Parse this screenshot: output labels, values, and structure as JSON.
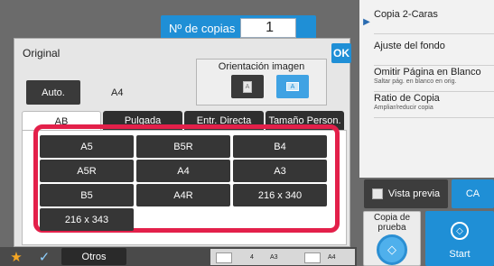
{
  "copies": {
    "label": "Nº de copias",
    "value": "1"
  },
  "dialog": {
    "title": "Original",
    "ok_label": "OK",
    "orientation_label": "Orientación imagen",
    "orientation_portrait_glyph": "A",
    "orientation_landscape_glyph": "A",
    "auto_label": "Auto.",
    "auto_size": "A4",
    "tabs": [
      "AB",
      "Pulgada",
      "Entr. Directa",
      "Tamaño Person."
    ],
    "sizes": [
      "A5",
      "B5R",
      "B4",
      "A5R",
      "A4",
      "A3",
      "B5",
      "A4R",
      "216 x 340",
      "216 x 343"
    ]
  },
  "right_panel": {
    "items": [
      {
        "title": "Copia 2-Caras",
        "sub": ""
      },
      {
        "title": "Ajuste del fondo",
        "sub": ""
      },
      {
        "title": "Omitir Página en Blanco",
        "sub": "Saltar pág. en blanco en orig."
      },
      {
        "title": "Ratio de Copia",
        "sub": "Ampliar/reducir copia"
      }
    ],
    "preview_label": "Vista previa",
    "ca_label": "CA",
    "proof_label": "Copia de prueba",
    "start_label": "Start"
  },
  "bottom": {
    "otros_label": "Otros",
    "mini_labels": [
      "4",
      "A3",
      "A4"
    ]
  },
  "colors": {
    "accent": "#1f8fd6",
    "highlight": "#e3204a"
  }
}
